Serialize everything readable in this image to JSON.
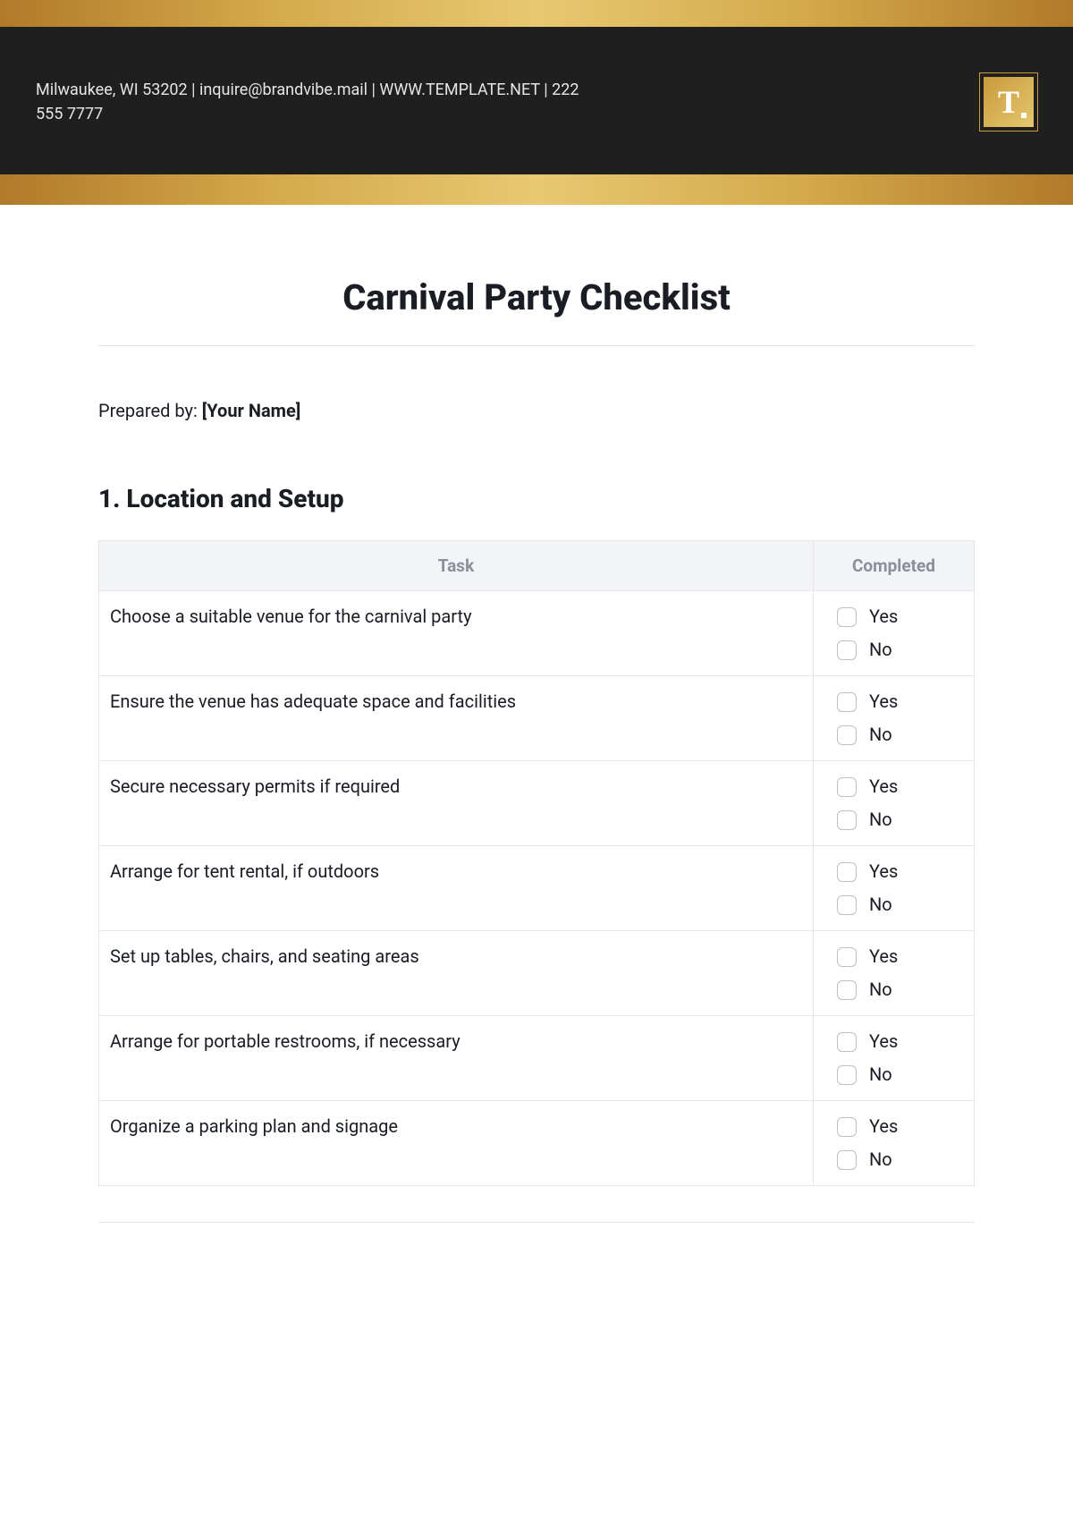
{
  "header": {
    "contact_line": "Milwaukee, WI 53202 | inquire@brandvibe.mail | WWW.TEMPLATE.NET | 222 555 7777",
    "logo_letter": "T"
  },
  "title": "Carnival Party Checklist",
  "prepared_by": {
    "label": "Prepared by: ",
    "value": "[Your Name]"
  },
  "section": {
    "heading": "1. Location and Setup",
    "columns": {
      "task": "Task",
      "completed": "Completed"
    },
    "options": {
      "yes": "Yes",
      "no": "No"
    },
    "tasks": [
      "Choose a suitable venue for the carnival party",
      "Ensure the venue has adequate space and facilities",
      "Secure necessary permits if required",
      "Arrange for tent rental, if outdoors",
      "Set up tables, chairs, and seating areas",
      "Arrange for portable restrooms, if necessary",
      "Organize a parking plan and signage"
    ]
  }
}
